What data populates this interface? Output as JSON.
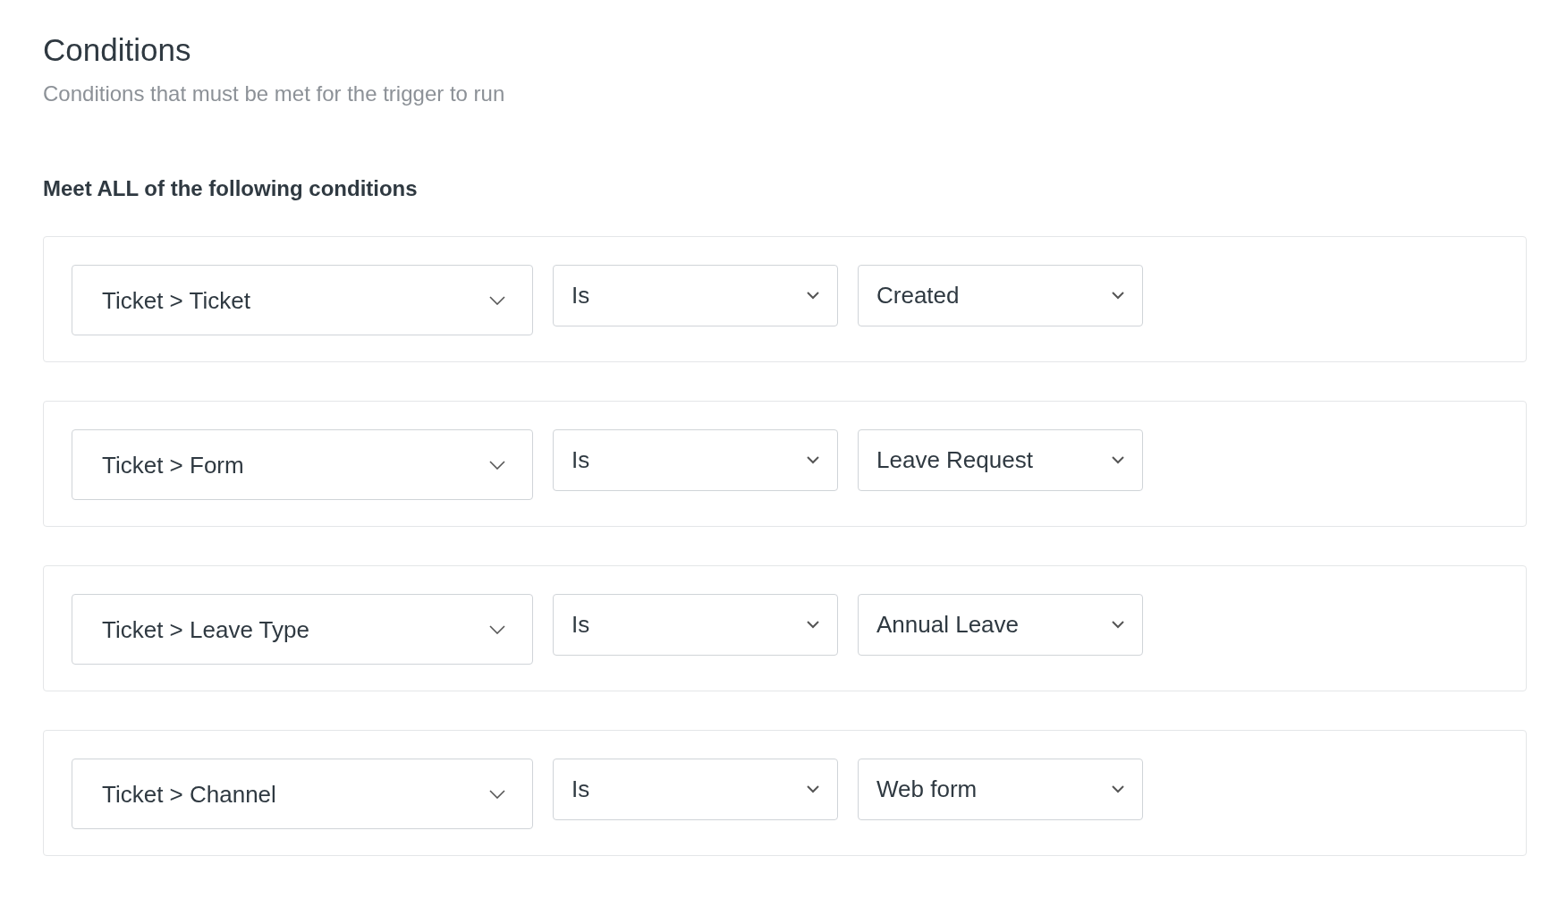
{
  "header": {
    "title": "Conditions",
    "subtitle": "Conditions that must be met for the trigger to run"
  },
  "group": {
    "heading": "Meet ALL of the following conditions"
  },
  "conditions": [
    {
      "field": "Ticket > Ticket",
      "operator": "Is",
      "value": "Created"
    },
    {
      "field": "Ticket > Form",
      "operator": "Is",
      "value": "Leave Request"
    },
    {
      "field": "Ticket > Leave Type",
      "operator": "Is",
      "value": "Annual Leave"
    },
    {
      "field": "Ticket > Channel",
      "operator": "Is",
      "value": "Web form"
    }
  ]
}
